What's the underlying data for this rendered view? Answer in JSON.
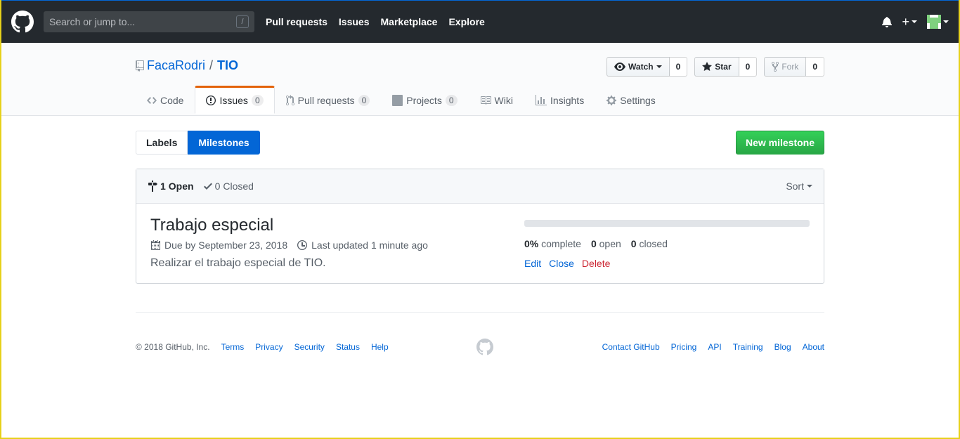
{
  "header": {
    "search_placeholder": "Search or jump to...",
    "search_shortcut": "/",
    "nav": [
      "Pull requests",
      "Issues",
      "Marketplace",
      "Explore"
    ]
  },
  "repo": {
    "owner": "FacaRodri",
    "separator": "/",
    "name": "TIO",
    "watch_label": "Watch",
    "watch_count": "0",
    "star_label": "Star",
    "star_count": "0",
    "fork_label": "Fork",
    "fork_count": "0"
  },
  "tabs": [
    {
      "label": "Code",
      "icon": "code-icon"
    },
    {
      "label": "Issues",
      "icon": "issue-icon",
      "count": "0"
    },
    {
      "label": "Pull requests",
      "icon": "pull-request-icon",
      "count": "0"
    },
    {
      "label": "Projects",
      "icon": "project-icon",
      "count": "0"
    },
    {
      "label": "Wiki",
      "icon": "book-icon"
    },
    {
      "label": "Insights",
      "icon": "graph-icon"
    },
    {
      "label": "Settings",
      "icon": "gear-icon"
    }
  ],
  "subnav": {
    "labels": "Labels",
    "milestones": "Milestones",
    "new_milestone": "New milestone"
  },
  "list": {
    "open_count": "1",
    "open_label": "Open",
    "closed_count": "0",
    "closed_label": "Closed",
    "sort": "Sort"
  },
  "milestone": {
    "title": "Trabajo especial",
    "due": "Due by September 23, 2018",
    "updated": "Last updated 1 minute ago",
    "description": "Realizar el trabajo especial de TIO.",
    "percent": "0%",
    "percent_label": "complete",
    "open_count": "0",
    "open_label": "open",
    "closed_count": "0",
    "closed_label": "closed",
    "progress": 0,
    "edit": "Edit",
    "close": "Close",
    "delete": "Delete"
  },
  "footer": {
    "copyright": "© 2018 GitHub, Inc.",
    "left_links": [
      "Terms",
      "Privacy",
      "Security",
      "Status",
      "Help"
    ],
    "right_links": [
      "Contact GitHub",
      "Pricing",
      "API",
      "Training",
      "Blog",
      "About"
    ]
  },
  "colors": {
    "header_bg": "#24292e",
    "link": "#0366d6",
    "primary": "#28a745",
    "danger": "#cb2431",
    "tab_accent": "#e36209"
  }
}
